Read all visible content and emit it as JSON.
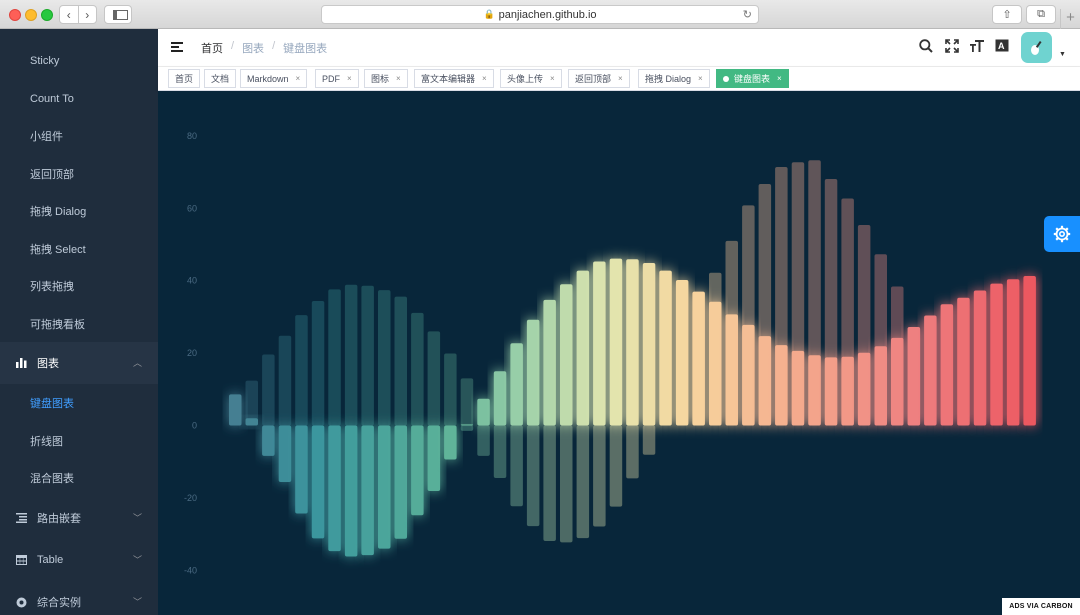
{
  "browser": {
    "url": "panjiachen.github.io",
    "back_icon": "‹",
    "forward_icon": "›",
    "reload_icon": "↻",
    "new_tab_icon": "+",
    "share_icon": "⇧",
    "tabs_icon": "⧉"
  },
  "sidebar": {
    "items": [
      {
        "label": "Sticky"
      },
      {
        "label": "Count To"
      },
      {
        "label": "小组件"
      },
      {
        "label": "返回顶部"
      },
      {
        "label": "拖拽 Dialog"
      },
      {
        "label": "拖拽 Select"
      },
      {
        "label": "列表拖拽"
      },
      {
        "label": "可拖拽看板"
      }
    ],
    "chart_group": {
      "label": "图表",
      "icon": "chart-icon"
    },
    "chart_items": [
      {
        "label": "键盘图表",
        "active": true
      },
      {
        "label": "折线图"
      },
      {
        "label": "混合图表"
      }
    ],
    "groups": [
      {
        "label": "路由嵌套",
        "icon": "nested-icon"
      },
      {
        "label": "Table",
        "icon": "table-icon"
      },
      {
        "label": "综合实例",
        "icon": "example-icon"
      }
    ]
  },
  "header": {
    "breadcrumb": [
      "首页",
      "图表",
      "键盘图表"
    ]
  },
  "tags": [
    {
      "label": "首页",
      "closable": false
    },
    {
      "label": "文档",
      "closable": false
    },
    {
      "label": "Markdown",
      "closable": true
    },
    {
      "label": "PDF",
      "closable": true
    },
    {
      "label": "图标",
      "closable": true
    },
    {
      "label": "富文本编辑器",
      "closable": true
    },
    {
      "label": "头像上传",
      "closable": true
    },
    {
      "label": "返回顶部",
      "closable": true
    },
    {
      "label": "拖拽 Dialog",
      "closable": true
    },
    {
      "label": "键盘图表",
      "closable": true,
      "active": true
    }
  ],
  "tag_close_glyph": "×",
  "ads_label": "ADS VIA CARBON",
  "colors": {
    "sidebar_bg": "#1f2d3d",
    "active_tag": "#42b983",
    "chart_bg": "#08263a",
    "link_active": "#409eff",
    "settings_button": "#1890ff"
  },
  "chart_data": {
    "type": "bar",
    "ylim": [
      -45,
      85
    ],
    "yticks": [
      "80",
      "60",
      "40",
      "20",
      "0",
      "-20",
      "-40"
    ],
    "ytick_values": [
      80,
      60,
      40,
      20,
      0,
      -20,
      -40
    ],
    "series": [
      {
        "values": [
          6.7,
          12.4,
          19.6,
          24.8,
          30.5,
          34.4,
          37.6,
          38.9,
          38.6,
          37.4,
          35.6,
          31.1,
          26.0,
          19.9,
          13.0
        ]
      },
      {
        "values": [
          8.6,
          2.0,
          -8.4,
          -15.6,
          -24.3,
          -31.2,
          -34.7,
          -36.2,
          -35.8,
          -34.0,
          -31.3,
          -24.8,
          -18.1,
          -9.4,
          0.3
        ]
      },
      {
        "values": [
          7.4,
          15.0,
          22.7,
          29.2,
          34.7,
          39.0,
          42.8,
          45.3,
          46.1,
          45.9,
          44.9,
          42.8,
          40.2,
          37.0,
          34.2,
          30.7,
          27.8,
          24.7,
          22.2,
          20.6,
          19.4,
          18.8,
          19.0,
          20.1,
          21.9,
          24.2,
          27.2,
          30.4,
          33.5,
          35.3,
          37.3,
          39.2,
          40.4,
          41.3
        ]
      },
      {
        "values": [
          -1.5,
          -8.4,
          -14.5,
          -22.3,
          -27.8,
          -31.9,
          -32.3,
          -31.1,
          -27.9,
          -22.4,
          -14.6,
          -8.1,
          0.0,
          0.0,
          32.2,
          42.2,
          51.0,
          60.8,
          66.7,
          71.4,
          72.7,
          73.3,
          68.1,
          62.7,
          55.4,
          47.3,
          38.4,
          27.2
        ]
      }
    ]
  }
}
